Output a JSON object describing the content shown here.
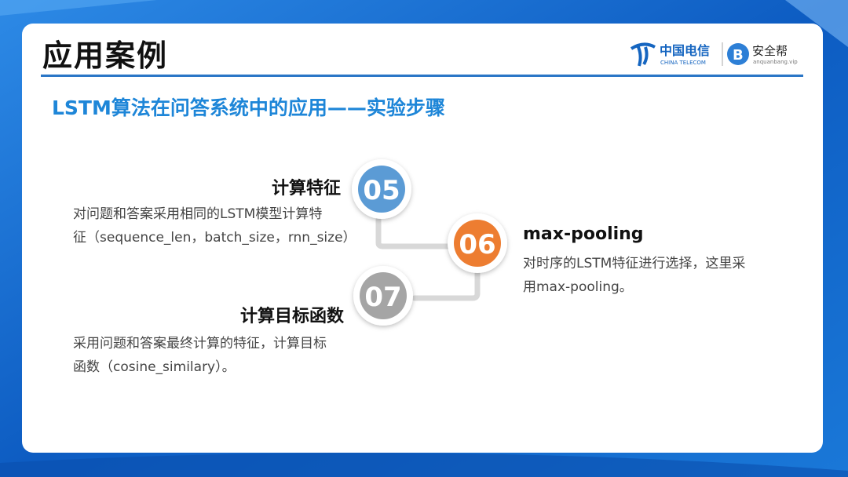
{
  "page": {
    "title": "应用案例",
    "subtitle": "LSTM算法在问答系统中的应用——实验步骤"
  },
  "logo": {
    "brand_cn": "中国电信",
    "brand_en": "CHINA TELECOM",
    "partner_cn": "安全帮",
    "partner_site": "anquanbang.vip",
    "icon": "china-telecom-logo"
  },
  "steps": [
    {
      "number": "05",
      "title": "计算特征",
      "desc_line1": "对问题和答案采用相同的LSTM模型计算特",
      "desc_line2": "征（sequence_len，batch_size，rnn_size）",
      "color": "#5b9bd5"
    },
    {
      "number": "06",
      "title": "max-pooling",
      "desc_line1": "对时序的LSTM特征进行选择，这里采",
      "desc_line2": "用max-pooling。",
      "color": "#ed7d31"
    },
    {
      "number": "07",
      "title": "计算目标函数",
      "desc_line1": "采用问题和答案最终计算的特征，计算目标",
      "desc_line2": "函数（cosine_similary）。",
      "color": "#a5a5a5"
    }
  ],
  "colors": {
    "accent_blue": "#1e86d8",
    "divider": "#2a76c6",
    "background": "#1a6fd0"
  }
}
